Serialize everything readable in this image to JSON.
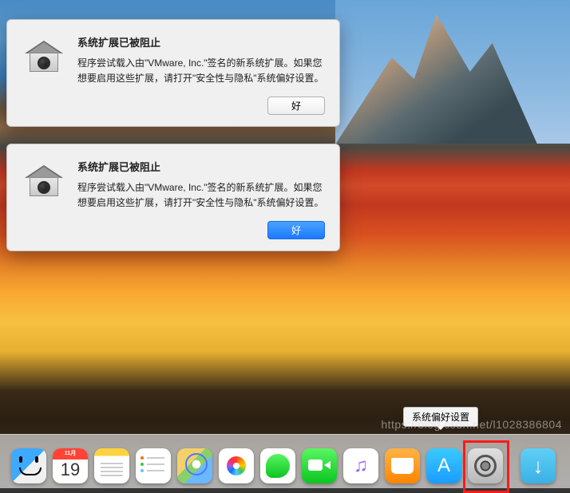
{
  "dialog1": {
    "title": "系统扩展已被阻止",
    "message": "程序尝试载入由\"VMware, Inc.\"签名的新系统扩展。如果您想要启用这些扩展，请打开\"安全性与隐私\"系统偏好设置。",
    "button": "好"
  },
  "dialog2": {
    "title": "系统扩展已被阻止",
    "message": "程序尝试载入由\"VMware, Inc.\"签名的新系统扩展。如果您想要启用这些扩展，请打开\"安全性与隐私\"系统偏好设置。",
    "button": "好"
  },
  "tooltip": {
    "text": "系统偏好设置"
  },
  "dock": {
    "calendar": {
      "month": "11月",
      "day": "19"
    }
  },
  "watermark": "https://blog.csdn.net/l1028386804"
}
